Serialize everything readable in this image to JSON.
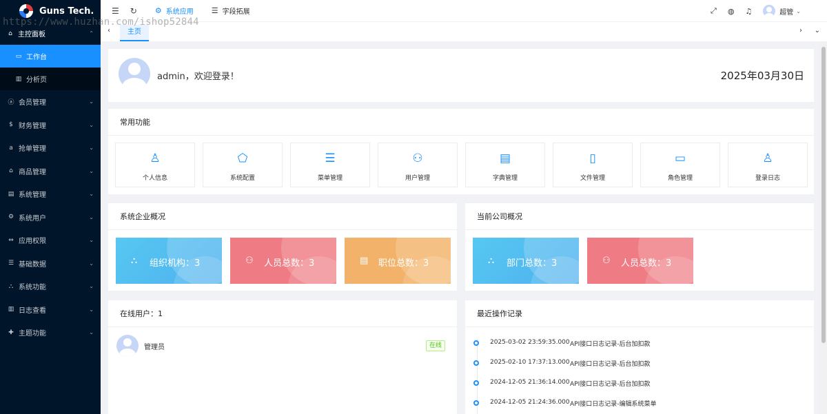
{
  "brand": {
    "name": "Guns Tech."
  },
  "sidebar": {
    "head": {
      "icon": "home-icon",
      "label": "主控面板"
    },
    "subitems": [
      {
        "icon": "monitor-icon",
        "label": "工作台",
        "active": true
      },
      {
        "icon": "bar-chart-icon",
        "label": "分析页",
        "active": false
      }
    ],
    "items": [
      {
        "icon": "user-icon",
        "label": "会员管理"
      },
      {
        "icon": "dollar-icon",
        "label": "财务管理"
      },
      {
        "icon": "amazon-icon",
        "label": "抢单管理"
      },
      {
        "icon": "shop-icon",
        "label": "商品管理"
      },
      {
        "icon": "database-icon",
        "label": "系统管理"
      },
      {
        "icon": "gear-icon",
        "label": "系统用户"
      },
      {
        "icon": "permission-icon",
        "label": "应用权限"
      },
      {
        "icon": "list-icon",
        "label": "基础数据"
      },
      {
        "icon": "cluster-icon",
        "label": "系统功能"
      },
      {
        "icon": "chart-icon",
        "label": "日志查看"
      },
      {
        "icon": "theme-icon",
        "label": "主题功能"
      }
    ]
  },
  "topbar": {
    "nav": [
      {
        "icon": "gear-icon",
        "label": "系统应用",
        "active": true
      },
      {
        "icon": "list-icon",
        "label": "字段拓展",
        "active": false
      }
    ],
    "username": "超管"
  },
  "tabs": {
    "home": "主页"
  },
  "watermark": "https://www.huzhan.com/ishop52844",
  "welcome": {
    "greeting": "admin，欢迎登录！",
    "date": "2025年03月30日"
  },
  "common_functions": {
    "title": "常用功能",
    "items": [
      {
        "icon": "user-icon",
        "label": "个人信息"
      },
      {
        "icon": "pentagon-gear-icon",
        "label": "系统配置"
      },
      {
        "icon": "list-icon",
        "label": "菜单管理"
      },
      {
        "icon": "team-icon",
        "label": "用户管理"
      },
      {
        "icon": "book-icon",
        "label": "字典管理"
      },
      {
        "icon": "file-icon",
        "label": "文件管理"
      },
      {
        "icon": "id-card-icon",
        "label": "角色管理"
      },
      {
        "icon": "user-log-icon",
        "label": "登录日志"
      }
    ]
  },
  "system_overview": {
    "title": "系统企业概况",
    "stats": [
      {
        "icon": "cluster-icon",
        "text": "组织机构：3",
        "color": "#56c8f2"
      },
      {
        "icon": "team-icon",
        "text": "人员总数：3",
        "color": "#ef7c84"
      },
      {
        "icon": "doc-icon",
        "text": "职位总数：3",
        "color": "#f3b26a"
      }
    ]
  },
  "company_overview": {
    "title": "当前公司概况",
    "stats": [
      {
        "icon": "cluster-icon",
        "text": "部门总数：3",
        "color": "#56c8f2"
      },
      {
        "icon": "team-icon",
        "text": "人员总数：3",
        "color": "#ef7c84"
      }
    ]
  },
  "online_users": {
    "title": "在线用户：1",
    "users": [
      {
        "name": "管理员",
        "status": "在线"
      }
    ]
  },
  "recent_logs": {
    "title": "最近操作记录",
    "items": [
      {
        "time": "2025-03-02 23:59:35.000",
        "desc": "API接口日志记录-后台加扣款"
      },
      {
        "time": "2025-02-10 17:37:13.000",
        "desc": "API接口日志记录-后台加扣款"
      },
      {
        "time": "2024-12-05 21:36:14.000",
        "desc": "API接口日志记录-后台加扣款"
      },
      {
        "time": "2024-12-05 21:24:36.000",
        "desc": "API接口日志记录-编辑系统菜单"
      }
    ]
  },
  "colors": {
    "primary": "#1890ff",
    "sidebar_bg": "#001529",
    "success": "#52c41a"
  }
}
